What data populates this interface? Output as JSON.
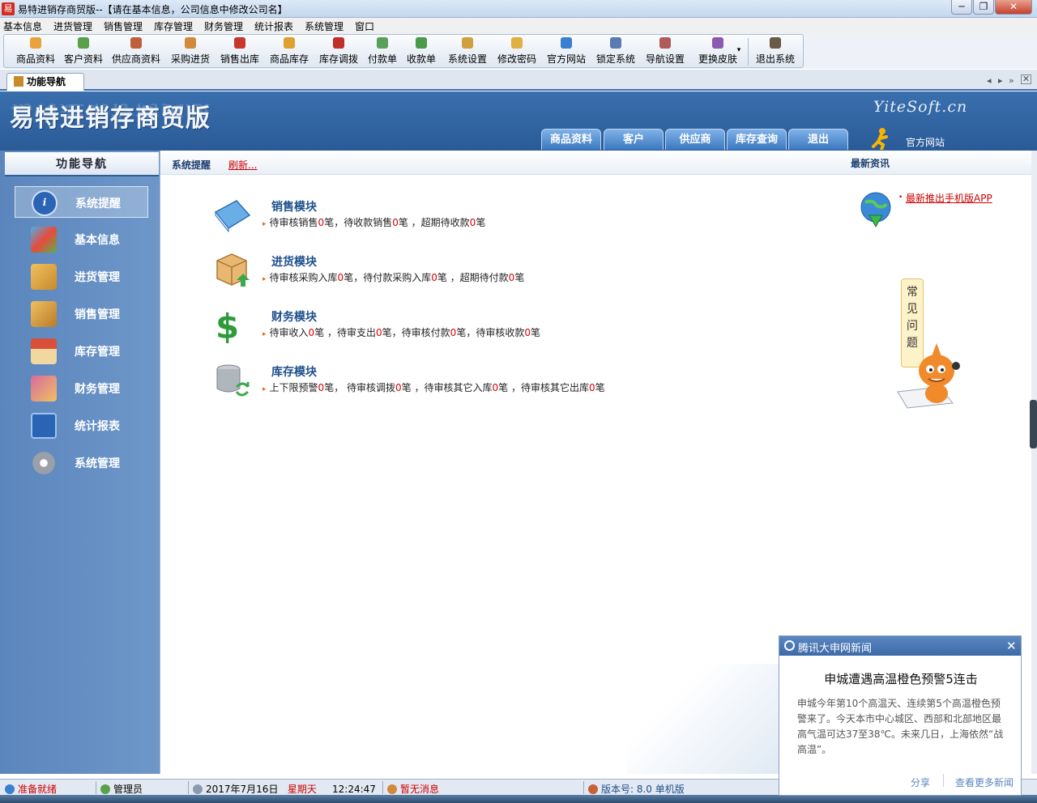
{
  "window": {
    "title": "易特进销存商贸版--【请在基本信息，公司信息中修改公司名】",
    "app_icon": "易",
    "min": "─",
    "max": "❐",
    "close": "✕"
  },
  "menu": [
    "基本信息",
    "进货管理",
    "销售管理",
    "库存管理",
    "财务管理",
    "统计报表",
    "系统管理",
    "窗口"
  ],
  "toolbar": [
    {
      "label": "商品资料",
      "color": "#e8a33a"
    },
    {
      "label": "客户资料",
      "color": "#5aa04a"
    },
    {
      "label": "供应商资料",
      "color": "#c0603a"
    },
    {
      "label": "采购进货",
      "color": "#d08a3a"
    },
    {
      "label": "销售出库",
      "color": "#c8362e"
    },
    {
      "label": "商品库存",
      "color": "#e0a030"
    },
    {
      "label": "库存调拨",
      "color": "#c0302a"
    },
    {
      "label": "付款单",
      "color": "#5aa05a"
    },
    {
      "label": "收款单",
      "color": "#4a9a4a"
    },
    {
      "label": "系统设置",
      "color": "#d0a040"
    },
    {
      "label": "修改密码",
      "color": "#e0b040"
    },
    {
      "label": "官方网站",
      "color": "#3a80d0"
    },
    {
      "label": "锁定系统",
      "color": "#5a7ab0"
    },
    {
      "label": "导航设置",
      "color": "#b05a5a"
    },
    {
      "label": "更换皮肤",
      "color": "#8a5ab0"
    },
    {
      "label": "退出系统",
      "color": "#6a5a4a"
    }
  ],
  "tab": {
    "label": "功能导航"
  },
  "banner": {
    "title": "易特进销存商贸版",
    "brand": "YiteSoft.cn",
    "tabs": [
      "商品资料",
      "客户",
      "供应商",
      "库存查询",
      "退出"
    ],
    "official_site": "官方网站"
  },
  "nav": {
    "header": "功能导航",
    "items": [
      {
        "label": "系统提醒",
        "color": "#2c64b5"
      },
      {
        "label": "基本信息",
        "color": "#3aa0d8"
      },
      {
        "label": "进货管理",
        "color": "#d89a3a"
      },
      {
        "label": "销售管理",
        "color": "#d08a2a"
      },
      {
        "label": "库存管理",
        "color": "#c8603a"
      },
      {
        "label": "财务管理",
        "color": "#b85a8a"
      },
      {
        "label": "统计报表",
        "color": "#4a8ac8"
      },
      {
        "label": "系统管理",
        "color": "#9aa0a8"
      }
    ]
  },
  "main": {
    "reminder_title": "系统提醒",
    "refresh": "刷新...",
    "news_title": "最新资讯",
    "news_link": "最新推出手机版APP",
    "faq": [
      "常",
      "见",
      "问",
      "题"
    ],
    "modules": [
      {
        "title": "销售模块",
        "parts": [
          {
            "t": "待审核销售"
          },
          {
            "n": "0"
          },
          {
            "t": "笔，待收款销售"
          },
          {
            "n": "0"
          },
          {
            "t": "笔 ，超期待收款"
          },
          {
            "n": "0"
          },
          {
            "t": "笔"
          }
        ]
      },
      {
        "title": "进货模块",
        "parts": [
          {
            "t": "待审核采购入库"
          },
          {
            "n": "0"
          },
          {
            "t": "笔，待付款采购入库"
          },
          {
            "n": "0"
          },
          {
            "t": "笔 ，超期待付款"
          },
          {
            "n": "0"
          },
          {
            "t": "笔"
          }
        ]
      },
      {
        "title": "财务模块",
        "parts": [
          {
            "t": "待审收入"
          },
          {
            "n": "0"
          },
          {
            "t": "笔 ，待审支出"
          },
          {
            "n": "0"
          },
          {
            "t": "笔，待审核付款"
          },
          {
            "n": "0"
          },
          {
            "t": "笔，待审核收款"
          },
          {
            "n": "0"
          },
          {
            "t": "笔"
          }
        ]
      },
      {
        "title": "库存模块",
        "parts": [
          {
            "t": "上下限预警"
          },
          {
            "n": "0"
          },
          {
            "t": "笔，  待审核调拨"
          },
          {
            "n": "0"
          },
          {
            "t": "笔 ，待审核其它入库"
          },
          {
            "n": "0"
          },
          {
            "t": "笔 ，待审核其它出库"
          },
          {
            "n": "0"
          },
          {
            "t": "笔"
          }
        ]
      }
    ]
  },
  "status": {
    "ready": "准备就绪",
    "user": "管理员",
    "date": "2017年7月16日",
    "weekday": "星期天",
    "time": "12:24:47",
    "messages": "暂无消息",
    "version": "版本号: 8.0 单机版"
  },
  "popup": {
    "source": "腾讯大申网新闻",
    "close": "✕",
    "headline": "申城遭遇高温橙色预警5连击",
    "body": "申城今年第10个高温天、连续第5个高温橙色预警来了。今天本市中心城区、西部和北部地区最高气温可达37至38℃。未来几日，上海依然“战高温”。",
    "share": "分享",
    "more": "查看更多新闻"
  }
}
